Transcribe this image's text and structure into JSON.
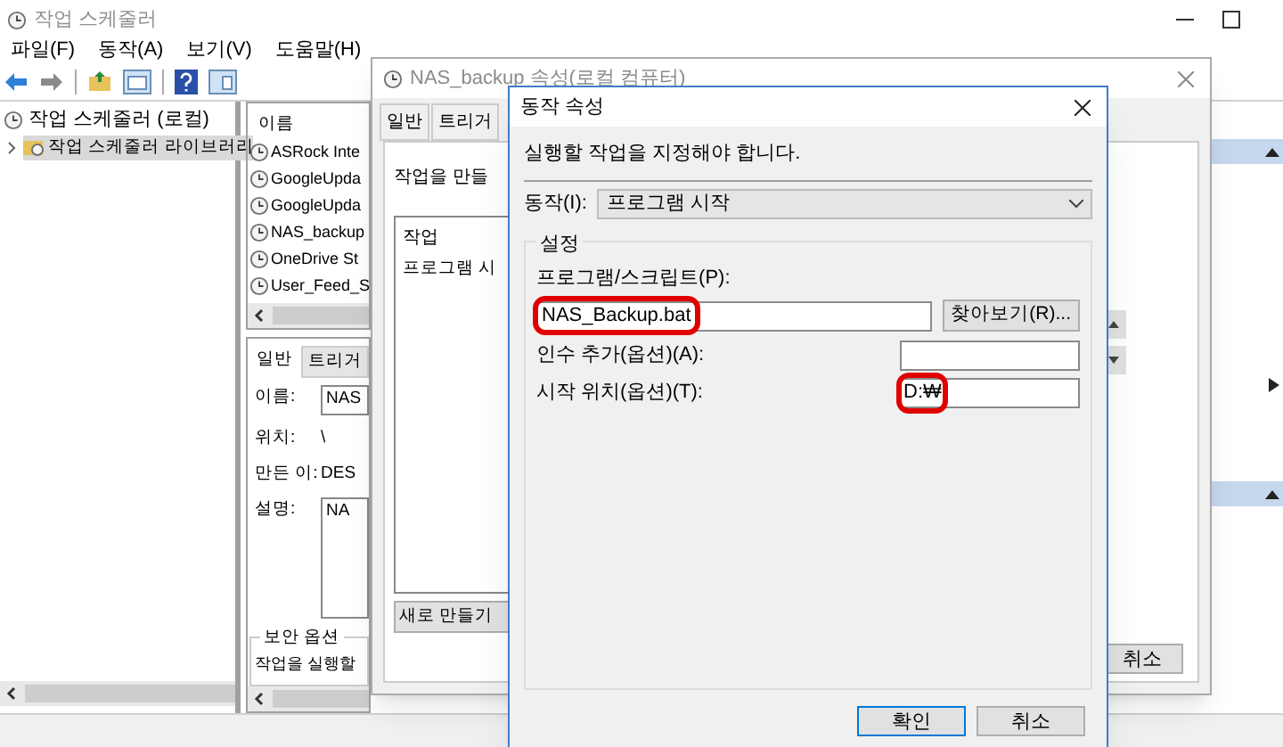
{
  "main_window": {
    "title": "작업 스케줄러",
    "menu": [
      "파일(F)",
      "동작(A)",
      "보기(V)",
      "도움말(H)"
    ],
    "tree": [
      {
        "label": "작업 스케줄러 (로컬)",
        "selected": false,
        "children": [
          {
            "label": "작업 스케줄러 라이브러리",
            "selected": true,
            "expanded": false
          }
        ]
      }
    ],
    "task_list": {
      "column": "이름",
      "rows": [
        "ASRock Inte",
        "GoogleUpda",
        "GoogleUpda",
        "NAS_backup",
        "OneDrive St",
        "User_Feed_S"
      ]
    },
    "detail_tabs": [
      {
        "label": "일반",
        "selected": true
      },
      {
        "label": "트리거",
        "selected": false
      }
    ],
    "details": [
      {
        "label": "이름:",
        "value": "NAS",
        "kind": "field"
      },
      {
        "label": "위치:",
        "value": "\\",
        "kind": "text"
      },
      {
        "label": "만든 이:",
        "value": "DES",
        "kind": "text"
      },
      {
        "label": "설명:",
        "value": "NA",
        "kind": "area"
      }
    ],
    "security": {
      "title": "보안 옵션",
      "text": "작업을 실행할"
    }
  },
  "properties_dialog": {
    "title": "NAS_backup 속성(로컬 컴퓨터)",
    "tabs": [
      {
        "label": "일반",
        "selected": false
      },
      {
        "label": "트리거",
        "selected": false
      }
    ],
    "intro": "작업을 만들",
    "actions_table": {
      "column": "작업",
      "rows": [
        "프로그램 시"
      ]
    },
    "new_button": "새로 만들기",
    "cancel_button": "취소"
  },
  "action_dialog": {
    "title": "동작 속성",
    "instruction": "실행할 작업을 지정해야 합니다.",
    "action_label": "동작(I):",
    "action_value": "프로그램 시작",
    "group_title": "설정",
    "program_label": "프로그램/스크립트(P):",
    "program_value": "NAS_Backup.bat",
    "program_highlighted": true,
    "browse_button": "찾아보기(R)...",
    "args_label": "인수 추가(옵션)(A):",
    "start_label": "시작 위치(옵션)(T):",
    "start_value": "D:₩",
    "start_highlighted": true,
    "ok_button": "확인",
    "cancel_button": "취소"
  }
}
